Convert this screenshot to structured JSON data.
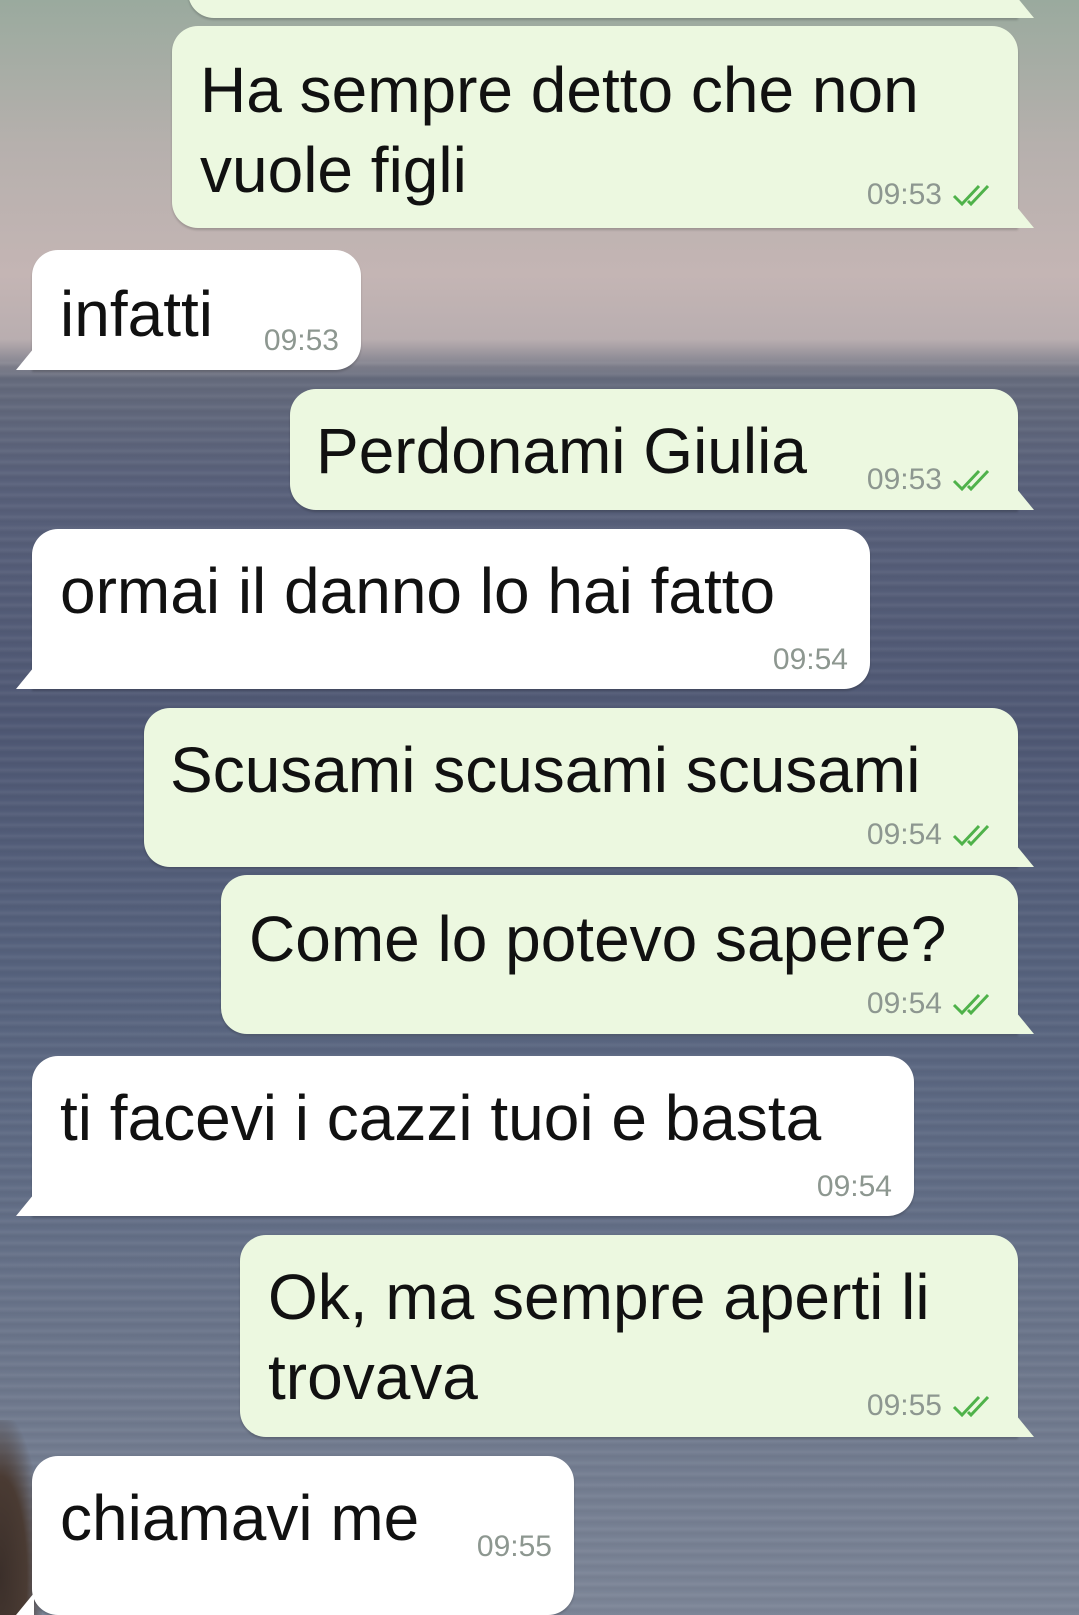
{
  "chat": {
    "messages": [
      {
        "direction": "out",
        "lines": [
          "Ha sempre detto che non",
          "vuole figli"
        ],
        "time": "09:53",
        "status": "read"
      },
      {
        "direction": "in",
        "lines": [
          "infatti"
        ],
        "time": "09:53"
      },
      {
        "direction": "out",
        "lines": [
          "Perdonami Giulia"
        ],
        "time": "09:53",
        "status": "read"
      },
      {
        "direction": "in",
        "lines": [
          "ormai il danno lo hai fatto"
        ],
        "time": "09:54"
      },
      {
        "direction": "out",
        "lines": [
          "Scusami scusami scusami"
        ],
        "time": "09:54",
        "status": "read"
      },
      {
        "direction": "out",
        "lines": [
          "Come lo potevo sapere?"
        ],
        "time": "09:54",
        "status": "read"
      },
      {
        "direction": "in",
        "lines": [
          "ti facevi i cazzi tuoi e basta"
        ],
        "time": "09:54"
      },
      {
        "direction": "out",
        "lines": [
          "Ok, ma sempre aperti li",
          "trovava"
        ],
        "time": "09:55",
        "status": "read"
      },
      {
        "direction": "in",
        "lines": [
          "chiamavi me"
        ],
        "time": "09:55"
      }
    ]
  },
  "colors": {
    "outgoing_bubble": "#ecf8e0",
    "incoming_bubble": "#ffffff",
    "read_ticks": "#4fb24a",
    "timestamp": "#8d9790"
  },
  "icons": {
    "read_status": "double-check-icon"
  }
}
